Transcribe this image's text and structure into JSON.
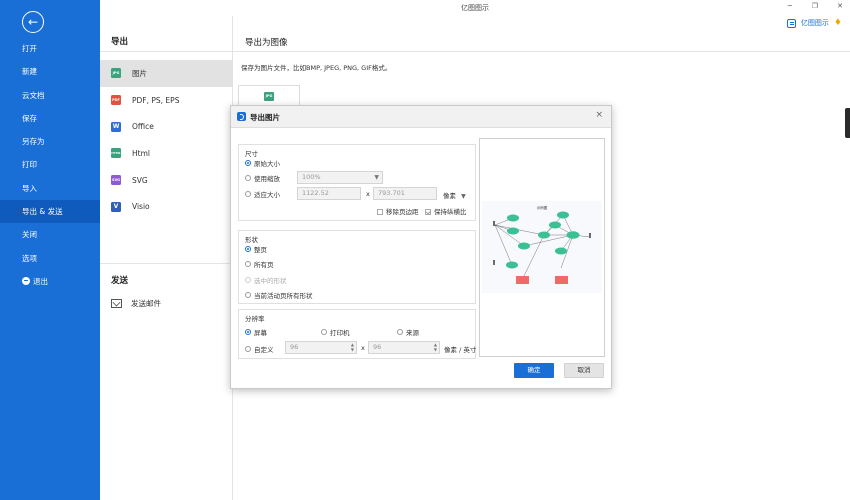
{
  "app": {
    "title": "亿图图示",
    "brand": "亿图图示"
  },
  "window_controls": {
    "minimize": "─",
    "restore": "❐",
    "close": "✕"
  },
  "sidebar": {
    "back": "←",
    "items": [
      {
        "label": "打开"
      },
      {
        "label": "新建"
      },
      {
        "label": "云文档"
      },
      {
        "label": "保存"
      },
      {
        "label": "另存为"
      },
      {
        "label": "打印"
      },
      {
        "label": "导入"
      },
      {
        "label": "导出 & 发送",
        "active": true
      },
      {
        "label": "关闭"
      },
      {
        "label": "选项"
      },
      {
        "label": "退出"
      }
    ]
  },
  "export_panel": {
    "heading": "导出",
    "formats": [
      {
        "label": "图片",
        "icon_text": "JPG",
        "icon_color": "#3aa27c",
        "active": true
      },
      {
        "label": "PDF, PS, EPS",
        "icon_text": "PDF",
        "icon_color": "#e0533e"
      },
      {
        "label": "Office",
        "icon_text": "W",
        "icon_color": "#2f6fd0"
      },
      {
        "label": "Html",
        "icon_text": "HTML",
        "icon_color": "#3aa27c"
      },
      {
        "label": "SVG",
        "icon_text": "SVG",
        "icon_color": "#8e5bd3"
      },
      {
        "label": "Visio",
        "icon_text": "V",
        "icon_color": "#2f5fb8"
      }
    ],
    "send_heading": "发送",
    "send_mail": "发送邮件"
  },
  "main": {
    "heading": "导出为图像",
    "description": "保存为图片文件，比如BMP, JPEG, PNG, GIF格式。",
    "card_icon": "JPG"
  },
  "dialog": {
    "title": "导出图片",
    "close": "×",
    "size": {
      "title": "尺寸",
      "original": "原始大小",
      "use_zoom": "使用缩放",
      "zoom_value": "100%",
      "fit_size": "适应大小",
      "width": "1122.52",
      "times": "x",
      "height": "793.701",
      "unit": "像素",
      "remove_margin": "移除页边距",
      "keep_ratio": "保持纵横比"
    },
    "shape": {
      "title": "形状",
      "whole_page": "整页",
      "all_pages": "所有页",
      "selected_shape": "选中的形状",
      "all_shapes_current_page": "当前活动页所有形状"
    },
    "resolution": {
      "title": "分辨率",
      "screen": "屏幕",
      "printer": "打印机",
      "source": "来源",
      "custom": "自定义",
      "x_dpi": "96",
      "times": "x",
      "y_dpi": "96",
      "unit": "像素 / 英寸"
    },
    "preview": {
      "diagram_title": "示例图"
    },
    "ok": "确定",
    "cancel": "取消"
  },
  "colors": {
    "sidebar": "#1a6fd6",
    "primary_button": "#1a6fd6",
    "preview_node": "#3dbf94",
    "preview_box": "#f06a6a"
  }
}
